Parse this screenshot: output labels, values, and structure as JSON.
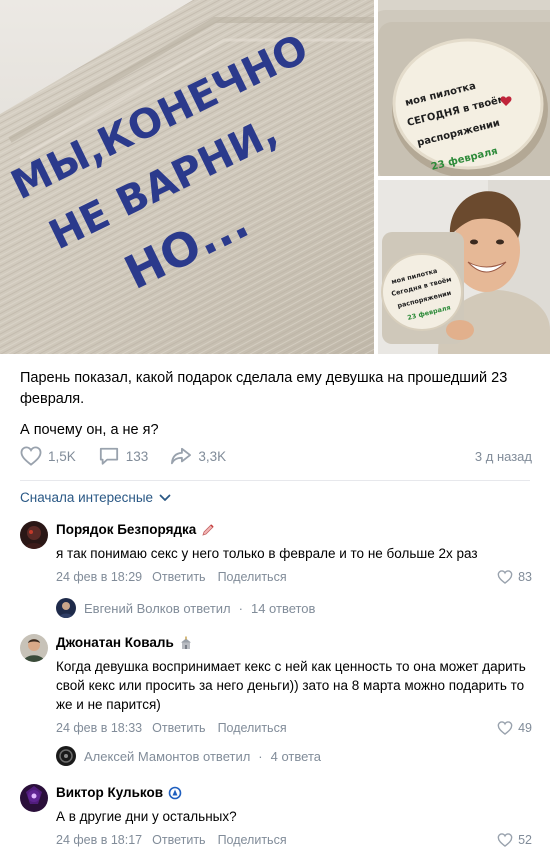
{
  "post": {
    "photos": {
      "main_box_text": [
        "МЫ,КОНЕЧНО",
        "НЕ ВАРНИ,",
        "НО..."
      ],
      "cake_text_top": [
        "моя пилотка",
        "СЕГОДНЯ в твоём",
        "распоряжении",
        "23 февраля"
      ],
      "cake_text_bottom": [
        "моя пилотка",
        "Сегодня в твоём",
        "распоряжении",
        "23 февраля"
      ]
    },
    "text_lines": [
      "Парень показал, какой подарок сделала ему девушка на прошедший 23 февраля.",
      "А почему он, а не я?"
    ],
    "likes": "1,5K",
    "comments": "133",
    "shares": "3,3K",
    "time": "3 д назад"
  },
  "sort_label": "Сначала интересные",
  "comments": [
    {
      "author": "Порядок Безпорядка",
      "text": "я так понимаю секс у него только в феврале и то не больше 2х раз",
      "date": "24 фев в 18:29",
      "reply_label": "Ответить",
      "share_label": "Поделиться",
      "likes": "83",
      "replies": {
        "author_line": "Евгений Волков ответил",
        "count": "14 ответов"
      }
    },
    {
      "author": "Джонатан Коваль",
      "text": "Когда девушка воспринимает кекс с ней как ценность то она может дарить свой кекс или просить за него деньги)) зато на 8 марта можно подарить то же и не парится)",
      "date": "24 фев в 18:33",
      "reply_label": "Ответить",
      "share_label": "Поделиться",
      "likes": "49",
      "replies": {
        "author_line": "Алексей Мамонтов ответил",
        "count": "4 ответа"
      }
    },
    {
      "author": "Виктор Кульков",
      "text": "А в другие дни у остальных?",
      "date": "24 фев в 18:17",
      "reply_label": "Ответить",
      "share_label": "Поделиться",
      "likes": "52"
    }
  ],
  "colors": {
    "link": "#2a5885",
    "muted": "#818c99",
    "separator": "#e7e8ec",
    "marker": "#2b3a8c"
  },
  "icons": [
    "like-icon",
    "comment-icon",
    "share-icon",
    "chevron-down-icon",
    "heart-icon",
    "pencil-badge-icon",
    "church-badge-icon",
    "dynamo-badge-icon"
  ]
}
